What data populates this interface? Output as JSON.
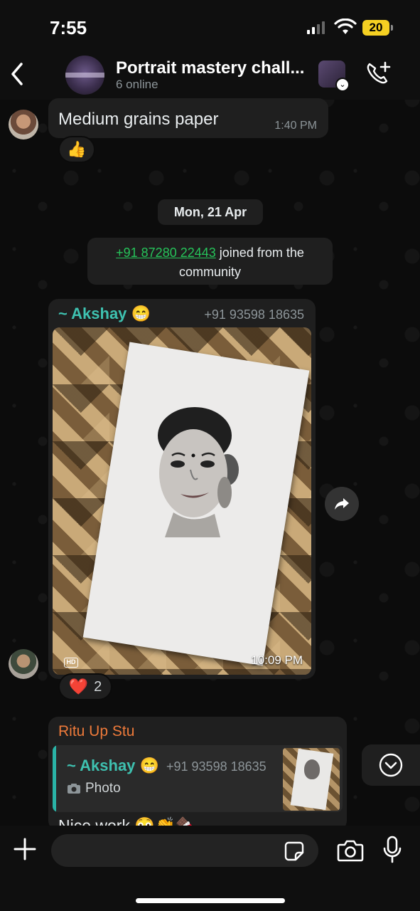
{
  "status_bar": {
    "time": "7:55",
    "battery": "20"
  },
  "header": {
    "title": "Portrait mastery chall...",
    "subtitle": "6 online",
    "avatar_text": "PORTRAIT MASTERY CHALLEN"
  },
  "messages": {
    "first": {
      "text": "Medium grains paper",
      "time": "1:40 PM",
      "reaction": "👍"
    },
    "date_separator": "Mon, 21 Apr",
    "system": {
      "phone": "+91 87280 22443",
      "text": " joined from the community"
    },
    "photo": {
      "sender": "~ Akshay 😁",
      "sender_color": "#3ec1b0",
      "phone": "+91 93598 18635",
      "hd": "HD",
      "time": "10:09 PM",
      "reaction_emoji": "❤️",
      "reaction_count": "2"
    },
    "reply": {
      "sender": "Ritu Up Stu",
      "sender_color": "#ee7a3a",
      "quoted_sender": "~ Akshay 😁",
      "quoted_phone": "+91 93598 18635",
      "quoted_type": "Photo",
      "text": "Nice work 😳👏🍫"
    }
  },
  "input": {
    "placeholder": ""
  },
  "colors": {
    "accent_green": "#26c45a",
    "bubble": "#1f1f1f"
  }
}
